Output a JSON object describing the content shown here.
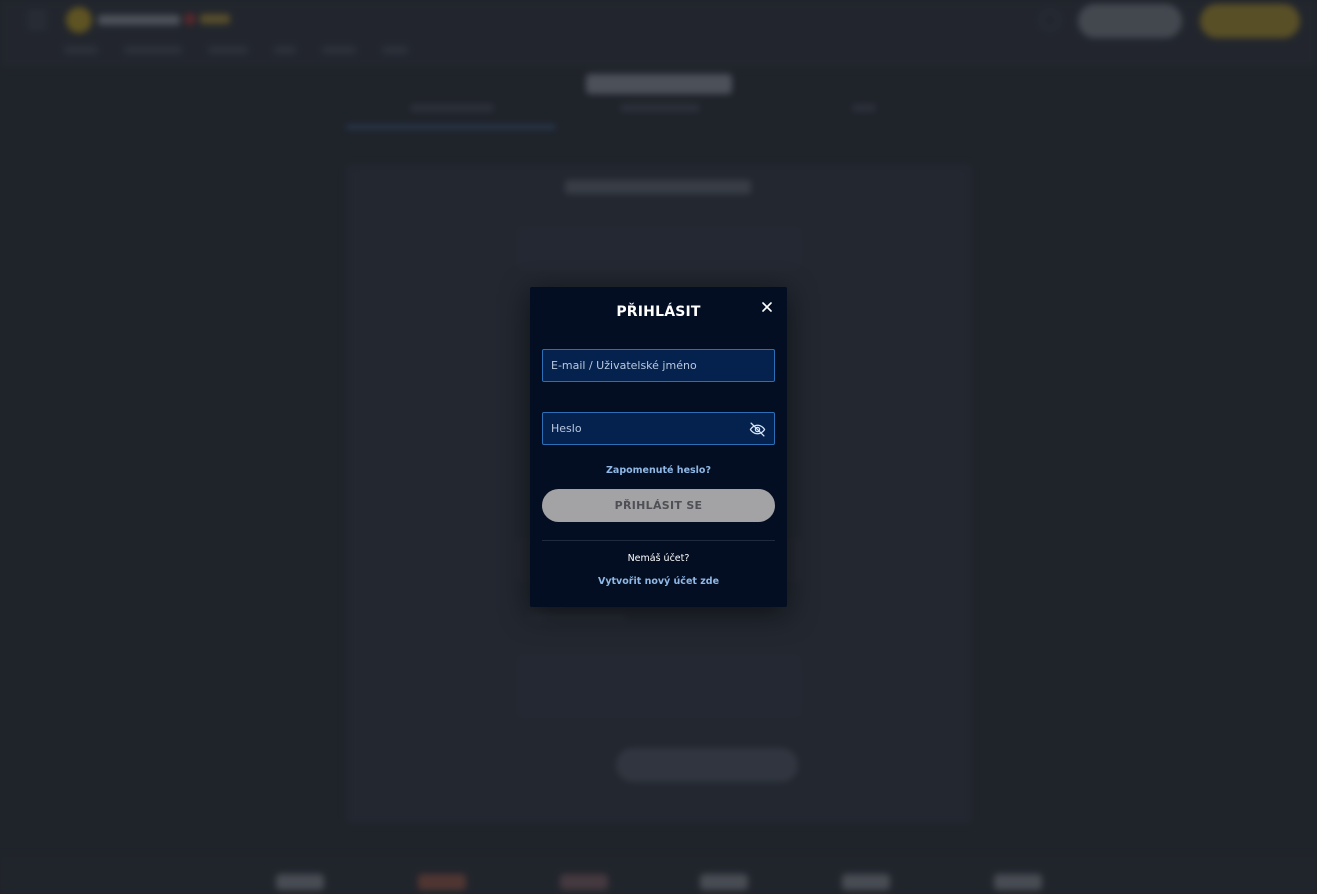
{
  "login_modal": {
    "title": "PŘIHLÁSIT",
    "email_placeholder": "E-mail / Uživatelské jméno",
    "password_placeholder": "Heslo",
    "forgot_password": "Zapomenuté heslo?",
    "submit_label": "PŘIHLÁSIT SE",
    "no_account": "Nemáš účet?",
    "create_account": "Vytvořit nový účet zde"
  },
  "icons": {
    "close": "close-icon",
    "password_visibility": "eye-off-icon"
  },
  "colors": {
    "modal_background": "#040e22",
    "field_background": "#05214d",
    "field_border": "#2d6fb6",
    "link": "#8fb8e6",
    "submit_button_disabled": "#a3a3a5",
    "brand_gold": "#c9a82a"
  }
}
